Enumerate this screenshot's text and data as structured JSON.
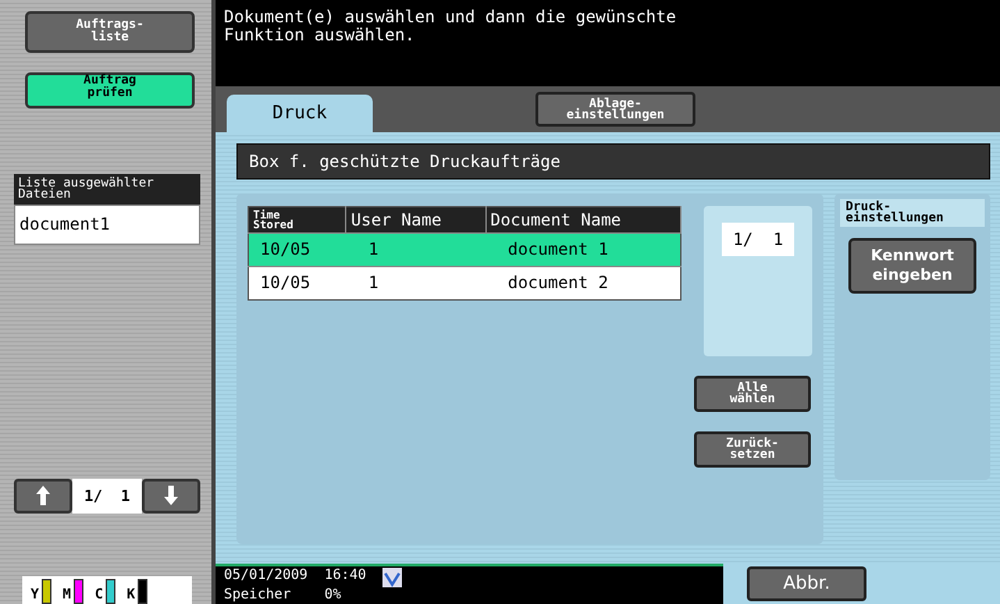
{
  "sidebar": {
    "buttons": [
      {
        "label": "Auftrags-\nliste",
        "selected": false
      },
      {
        "label": "Auftrag\nprüfen",
        "selected": true
      }
    ],
    "file_list": {
      "title": "Liste ausgewählter\nDateien",
      "items": [
        "document1"
      ]
    },
    "pager": {
      "reading": "1/  1"
    },
    "toner": [
      {
        "label": "Y",
        "color": "#c8c800"
      },
      {
        "label": "M",
        "color": "#ff00ff"
      },
      {
        "label": "C",
        "color": "#33cccc"
      },
      {
        "label": "K",
        "color": "#000000"
      }
    ]
  },
  "message": "Dokument(e) auswählen und dann die gewünschte\nFunktion auswählen.",
  "tabs": [
    {
      "label": "Druck",
      "selected": true
    }
  ],
  "settings_button": "Ablage-\neinstellungen",
  "box_title": "Box f. geschützte Druckaufträge",
  "table": {
    "columns": [
      "Time\nStored",
      "User Name",
      "Document Name"
    ],
    "rows": [
      {
        "cells": [
          "10/05",
          "1",
          "document 1"
        ],
        "selected": true
      },
      {
        "cells": [
          "10/05",
          "1",
          "document 2"
        ],
        "selected": false
      }
    ]
  },
  "page_counter": "1/  1",
  "actions": [
    "Alle\nwählen",
    "Zurück-\nsetzen"
  ],
  "print_settings": {
    "title": "Druck-\neinstellungen",
    "button": "Kennwort\neingeben"
  },
  "status_bar": {
    "date": "05/01/2009",
    "time": "16:40",
    "memory_label": "Speicher",
    "memory_value": "0%"
  },
  "cancel_button": "Abbr."
}
